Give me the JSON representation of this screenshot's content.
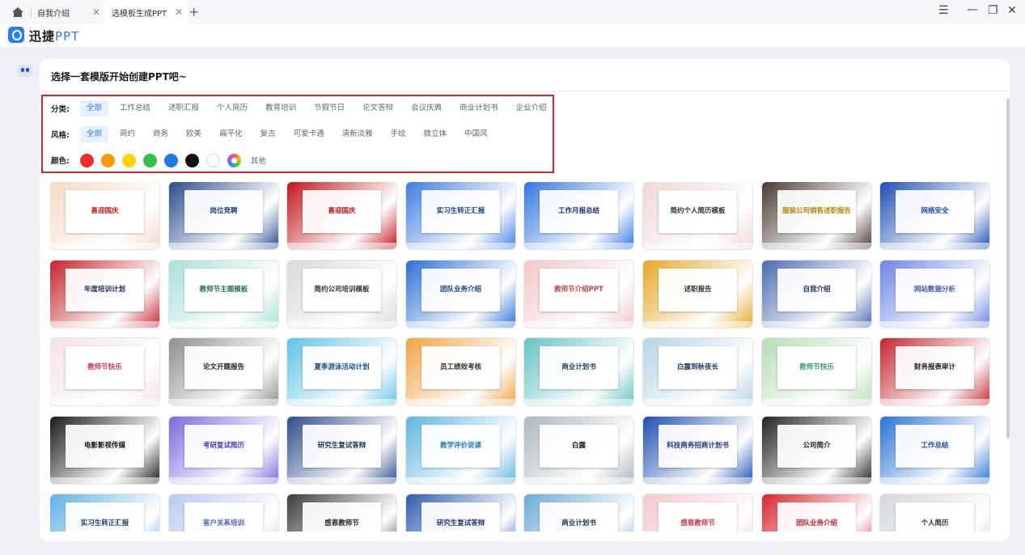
{
  "tabs": [
    {
      "label": "自我介绍",
      "active": false
    },
    {
      "label": "选模板生成PPT",
      "active": true
    }
  ],
  "window_controls": {
    "menu": "☰",
    "minimize": "—",
    "restore": "❐",
    "close": "✕"
  },
  "brand": {
    "name_cn": "迅捷",
    "name_en": "PPT",
    "accent": "#2b7cf6"
  },
  "panel": {
    "title": "选择一套模版开始创建PPT吧~"
  },
  "filters": {
    "category": {
      "label": "分类:",
      "items": [
        "全部",
        "工作总结",
        "述职汇报",
        "个人简历",
        "教育培训",
        "节假节日",
        "论文答辩",
        "会议庆典",
        "商业计划书",
        "企业介绍"
      ],
      "active": 0
    },
    "style": {
      "label": "风格:",
      "items": [
        "全部",
        "简约",
        "商务",
        "欧美",
        "扁平化",
        "复古",
        "可爱卡通",
        "清新淡雅",
        "手绘",
        "微立体",
        "中国风"
      ],
      "active": 0
    },
    "color": {
      "label": "颜色:",
      "swatches": [
        "#f02c2c",
        "#ff9a00",
        "#ffd400",
        "#35c046",
        "#1f78e6",
        "#111111",
        "#ffffff",
        "multi"
      ],
      "other_label": "其他"
    }
  },
  "templates": [
    {
      "title": "喜迎国庆",
      "bg": "#f6d9c5",
      "fg": "#c8171d"
    },
    {
      "title": "岗位竞聘",
      "bg": "#2a4d8f",
      "fg": "#1e3f7a"
    },
    {
      "title": "喜迎国庆",
      "bg": "#c4141b",
      "fg": "#c4141b"
    },
    {
      "title": "实习生转正汇报",
      "bg": "#3e7be0",
      "fg": "#1c3c85"
    },
    {
      "title": "工作月报总结",
      "bg": "#2f75e1",
      "fg": "#1b2f6b"
    },
    {
      "title": "简约个人简历模板",
      "bg": "#f1d6d6",
      "fg": "#333333"
    },
    {
      "title": "服装公司销售述职报告",
      "bg": "#4a3a32",
      "fg": "#b8860b"
    },
    {
      "title": "网络安全",
      "bg": "#1d4fb5",
      "fg": "#1d4fb5"
    },
    {
      "title": "年度培训计划",
      "bg": "#c5232b",
      "fg": "#1c2f5e"
    },
    {
      "title": "教师节主题模板",
      "bg": "#a8e0d8",
      "fg": "#2b6b62"
    },
    {
      "title": "简约公司培训模板",
      "bg": "#d9d9d9",
      "fg": "#333333"
    },
    {
      "title": "团队业务介绍",
      "bg": "#2b6fd6",
      "fg": "#1b3f86"
    },
    {
      "title": "教师节介绍PPT",
      "bg": "#f2c6c6",
      "fg": "#c2454b"
    },
    {
      "title": "述职报告",
      "bg": "#e6a826",
      "fg": "#333333"
    },
    {
      "title": "自我介绍",
      "bg": "#4a6bb0",
      "fg": "#1e2f5c"
    },
    {
      "title": "网站数据分析",
      "bg": "#6b83e6",
      "fg": "#4257c2"
    },
    {
      "title": "教师节快乐",
      "bg": "#f4e2e8",
      "fg": "#d0375b"
    },
    {
      "title": "论文开题报告",
      "bg": "#8e8e8e",
      "fg": "#222222"
    },
    {
      "title": "夏季游泳活动计划",
      "bg": "#5dc3e6",
      "fg": "#1c4c8a"
    },
    {
      "title": "员工绩效考核",
      "bg": "#f0a342",
      "fg": "#333333"
    },
    {
      "title": "商业计划书",
      "bg": "#66c2c5",
      "fg": "#1e3d5c"
    },
    {
      "title": "白露到秋夜长",
      "bg": "#b5d4e5",
      "fg": "#1d3b5c"
    },
    {
      "title": "教师节快乐",
      "bg": "#b7ddb4",
      "fg": "#3a9a74"
    },
    {
      "title": "财务报表审计",
      "bg": "#c4262e",
      "fg": "#222222"
    },
    {
      "title": "电影影视传媒",
      "bg": "#1a1a1a",
      "fg": "#111111"
    },
    {
      "title": "考研复试简历",
      "bg": "#7a6ae0",
      "fg": "#4a3bb8"
    },
    {
      "title": "研究生复试答辩",
      "bg": "#2c4c8a",
      "fg": "#1d2f55"
    },
    {
      "title": "教学评价说课",
      "bg": "#5db4e0",
      "fg": "#1e78c2"
    },
    {
      "title": "白露",
      "bg": "#a9b7bf",
      "fg": "#222222"
    },
    {
      "title": "科技商务招商计划书",
      "bg": "#1e4fb0",
      "fg": "#1e3a7a"
    },
    {
      "title": "公司简介",
      "bg": "#222222",
      "fg": "#222222"
    },
    {
      "title": "工作总结",
      "bg": "#2873d6",
      "fg": "#1c4aa0"
    },
    {
      "title": "实习生转正汇报",
      "bg": "#5fb1e6",
      "fg": "#1c3c6b"
    },
    {
      "title": "客户关系培训",
      "bg": "#b9c9f0",
      "fg": "#4a5fb8"
    },
    {
      "title": "感恩教师节",
      "bg": "#3a3a3a",
      "fg": "#222222"
    },
    {
      "title": "研究生复试答辩",
      "bg": "#2e5bb0",
      "fg": "#1c3570"
    },
    {
      "title": "商业计划书",
      "bg": "#6aa9d6",
      "fg": "#1c2f55"
    },
    {
      "title": "感恩教师节",
      "bg": "#f4c6cc",
      "fg": "#c8374b"
    },
    {
      "title": "团队业务介绍",
      "bg": "#d8262e",
      "fg": "#c0202a"
    },
    {
      "title": "个人简历",
      "bg": "#d2d6dc",
      "fg": "#333333"
    }
  ]
}
